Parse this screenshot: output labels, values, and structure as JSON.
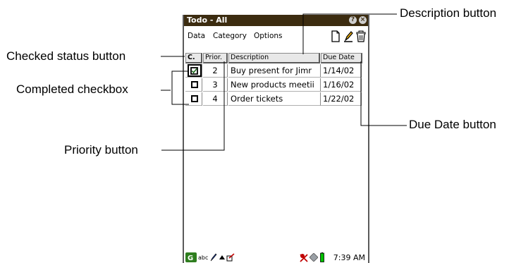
{
  "callouts": {
    "description_button": "Description button",
    "checked_status_button": "Checked status button",
    "completed_checkbox": "Completed checkbox",
    "due_date_button": "Due Date button",
    "priority_button": "Priority button"
  },
  "titlebar": {
    "title": "Todo - All",
    "help_icon": "?",
    "close_icon": "×"
  },
  "menu": {
    "items": [
      "Data",
      "Category",
      "Options"
    ]
  },
  "toolbar": {
    "icons": [
      "new-document-icon",
      "edit-pencil-icon",
      "trash-icon"
    ]
  },
  "table": {
    "headers": {
      "checked": "C.",
      "priority": "Prior.",
      "description": "Description",
      "due_date": "Due Date"
    },
    "rows": [
      {
        "completed": true,
        "priority": "2",
        "description": "Buy present for Jimr",
        "due_date": "1/14/02"
      },
      {
        "completed": false,
        "priority": "3",
        "description": "New products meetii",
        "due_date": "1/16/02"
      },
      {
        "completed": false,
        "priority": "4",
        "description": "Order tickets",
        "due_date": "1/22/02"
      }
    ]
  },
  "statusbar": {
    "input_mode": "abc",
    "time": "7:39 AM"
  },
  "colors": {
    "titlebar_bg": "#3c2c10",
    "header_bg": "#e8e8e8",
    "battery_green": "#00c000"
  }
}
